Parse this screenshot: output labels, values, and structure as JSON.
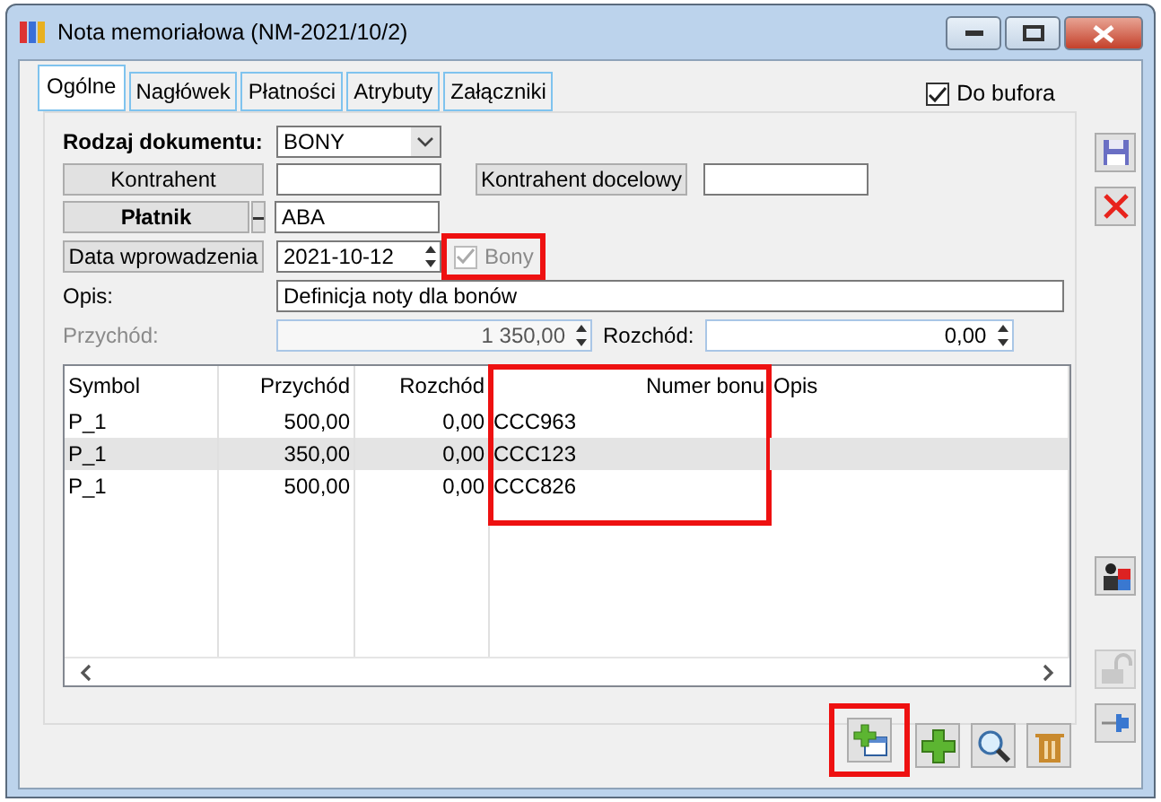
{
  "window": {
    "title": "Nota memoriałowa (NM-2021/10/2)"
  },
  "tabs": [
    {
      "label": "Ogólne",
      "selected": true
    },
    {
      "label": "Nagłówek",
      "selected": false
    },
    {
      "label": "Płatności",
      "selected": false
    },
    {
      "label": "Atrybuty",
      "selected": false
    },
    {
      "label": "Załączniki",
      "selected": false
    }
  ],
  "do_bufora": {
    "label": "Do bufora",
    "checked": true
  },
  "form": {
    "rodzaj": {
      "label": "Rodzaj dokumentu:",
      "value": "BONY"
    },
    "kontrahent": {
      "button": "Kontrahent"
    },
    "kontrahent_docelowy": {
      "button": "Kontrahent docelowy"
    },
    "platnik": {
      "button": "Płatnik",
      "value": "ABA"
    },
    "data": {
      "button": "Data wprowadzenia",
      "value": "2021-10-12"
    },
    "bony": {
      "label": "Bony",
      "checked": true,
      "disabled": true,
      "highlighted": true
    },
    "opis": {
      "label": "Opis:",
      "value": "Definicja noty dla bonów"
    },
    "przychod": {
      "label": "Przychód:",
      "value": "1 350,00",
      "disabled": true
    },
    "rozchod": {
      "label": "Rozchód:",
      "value": "0,00"
    }
  },
  "table": {
    "columns": [
      {
        "label": "Symbol",
        "highlighted": false
      },
      {
        "label": "Przychód",
        "highlighted": false
      },
      {
        "label": "Rozchód",
        "highlighted": false
      },
      {
        "label": "Numer bonu",
        "highlighted": true
      },
      {
        "label": "Opis",
        "highlighted": false
      }
    ],
    "rows": [
      {
        "cells": [
          "P_1",
          "500,00",
          "0,00",
          "CCC963",
          ""
        ],
        "selected": false
      },
      {
        "cells": [
          "P_1",
          "350,00",
          "0,00",
          "CCC123",
          ""
        ],
        "selected": true
      },
      {
        "cells": [
          "P_1",
          "500,00",
          "0,00",
          "CCC826",
          ""
        ],
        "selected": false
      }
    ]
  },
  "toolbar": [
    {
      "kind": "add-window",
      "highlighted": true
    },
    {
      "kind": "add",
      "highlighted": false
    },
    {
      "kind": "search",
      "highlighted": false
    },
    {
      "kind": "delete",
      "highlighted": false
    }
  ],
  "side_buttons": [
    {
      "kind": "save",
      "disabled": false
    },
    {
      "kind": "cancel",
      "disabled": false
    },
    {
      "kind": "person",
      "disabled": false
    },
    {
      "kind": "lock",
      "disabled": true
    },
    {
      "kind": "pin",
      "disabled": false
    }
  ]
}
